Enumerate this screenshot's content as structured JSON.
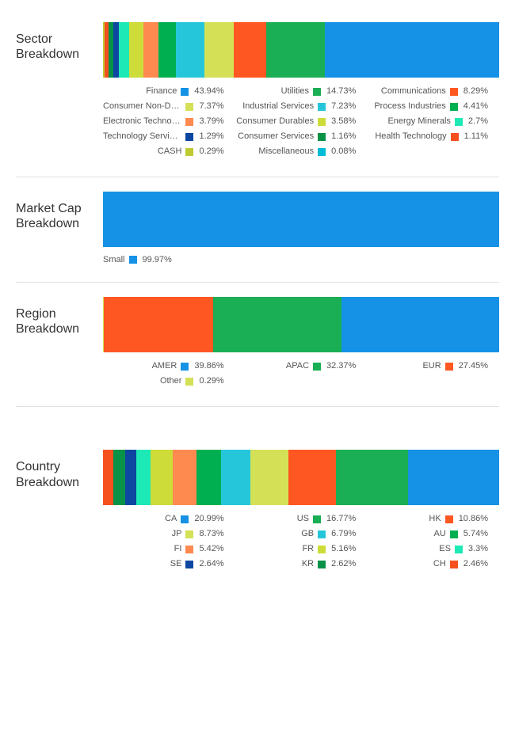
{
  "sections": [
    {
      "title": "Sector Breakdown",
      "legend_cols": 3,
      "items": [
        {
          "label": "Finance",
          "value": 43.94,
          "display": "43.94%",
          "color": "#1592e6"
        },
        {
          "label": "Utilities",
          "value": 14.73,
          "display": "14.73%",
          "color": "#1aaf54"
        },
        {
          "label": "Communications",
          "value": 8.29,
          "display": "8.29%",
          "color": "#ff5722"
        },
        {
          "label": "Consumer Non-Durables",
          "value": 7.37,
          "display": "7.37%",
          "color": "#d4e157"
        },
        {
          "label": "Industrial Services",
          "value": 7.23,
          "display": "7.23%",
          "color": "#26c6da"
        },
        {
          "label": "Process Industries",
          "value": 4.41,
          "display": "4.41%",
          "color": "#00b050"
        },
        {
          "label": "Electronic Technology",
          "value": 3.79,
          "display": "3.79%",
          "color": "#ff8a50"
        },
        {
          "label": "Consumer Durables",
          "value": 3.58,
          "display": "3.58%",
          "color": "#cddc39"
        },
        {
          "label": "Energy Minerals",
          "value": 2.7,
          "display": "2.7%",
          "color": "#1de9b6"
        },
        {
          "label": "Technology Services",
          "value": 1.29,
          "display": "1.29%",
          "color": "#0d47a1"
        },
        {
          "label": "Consumer Services",
          "value": 1.16,
          "display": "1.16%",
          "color": "#089247"
        },
        {
          "label": "Health Technology",
          "value": 1.11,
          "display": "1.11%",
          "color": "#f4511e"
        },
        {
          "label": "CASH",
          "value": 0.29,
          "display": "0.29%",
          "color": "#c0ca33"
        },
        {
          "label": "Miscellaneous",
          "value": 0.08,
          "display": "0.08%",
          "color": "#00bcd4"
        }
      ]
    },
    {
      "title": "Market Cap Breakdown",
      "legend_cols": 1,
      "items": [
        {
          "label": "Small",
          "value": 99.97,
          "display": "99.97%",
          "color": "#1592e6"
        }
      ]
    },
    {
      "title": "Region Breakdown",
      "legend_cols": 3,
      "items": [
        {
          "label": "AMER",
          "value": 39.86,
          "display": "39.86%",
          "color": "#1592e6"
        },
        {
          "label": "APAC",
          "value": 32.37,
          "display": "32.37%",
          "color": "#1aaf54"
        },
        {
          "label": "EUR",
          "value": 27.45,
          "display": "27.45%",
          "color": "#ff5722"
        },
        {
          "label": "Other",
          "value": 0.29,
          "display": "0.29%",
          "color": "#d4e157"
        }
      ]
    },
    {
      "title": "Country Breakdown",
      "legend_cols": 3,
      "spacer_before": true,
      "items": [
        {
          "label": "CA",
          "value": 20.99,
          "display": "20.99%",
          "color": "#1592e6"
        },
        {
          "label": "US",
          "value": 16.77,
          "display": "16.77%",
          "color": "#1aaf54"
        },
        {
          "label": "HK",
          "value": 10.86,
          "display": "10.86%",
          "color": "#ff5722"
        },
        {
          "label": "JP",
          "value": 8.73,
          "display": "8.73%",
          "color": "#d4e157"
        },
        {
          "label": "GB",
          "value": 6.79,
          "display": "6.79%",
          "color": "#26c6da"
        },
        {
          "label": "AU",
          "value": 5.74,
          "display": "5.74%",
          "color": "#00b050"
        },
        {
          "label": "FI",
          "value": 5.42,
          "display": "5.42%",
          "color": "#ff8a50"
        },
        {
          "label": "FR",
          "value": 5.16,
          "display": "5.16%",
          "color": "#cddc39"
        },
        {
          "label": "ES",
          "value": 3.3,
          "display": "3.3%",
          "color": "#1de9b6"
        },
        {
          "label": "SE",
          "value": 2.64,
          "display": "2.64%",
          "color": "#0d47a1"
        },
        {
          "label": "KR",
          "value": 2.62,
          "display": "2.62%",
          "color": "#089247"
        },
        {
          "label": "CH",
          "value": 2.46,
          "display": "2.46%",
          "color": "#f4511e"
        }
      ]
    }
  ],
  "chart_data": [
    {
      "type": "bar",
      "title": "Sector Breakdown",
      "orientation": "stacked-horizontal",
      "unit": "%",
      "series": [
        {
          "name": "Finance",
          "value": 43.94
        },
        {
          "name": "Utilities",
          "value": 14.73
        },
        {
          "name": "Communications",
          "value": 8.29
        },
        {
          "name": "Consumer Non-Durables",
          "value": 7.37
        },
        {
          "name": "Industrial Services",
          "value": 7.23
        },
        {
          "name": "Process Industries",
          "value": 4.41
        },
        {
          "name": "Electronic Technology",
          "value": 3.79
        },
        {
          "name": "Consumer Durables",
          "value": 3.58
        },
        {
          "name": "Energy Minerals",
          "value": 2.7
        },
        {
          "name": "Technology Services",
          "value": 1.29
        },
        {
          "name": "Consumer Services",
          "value": 1.16
        },
        {
          "name": "Health Technology",
          "value": 1.11
        },
        {
          "name": "CASH",
          "value": 0.29
        },
        {
          "name": "Miscellaneous",
          "value": 0.08
        }
      ]
    },
    {
      "type": "bar",
      "title": "Market Cap Breakdown",
      "orientation": "stacked-horizontal",
      "unit": "%",
      "series": [
        {
          "name": "Small",
          "value": 99.97
        }
      ]
    },
    {
      "type": "bar",
      "title": "Region Breakdown",
      "orientation": "stacked-horizontal",
      "unit": "%",
      "series": [
        {
          "name": "AMER",
          "value": 39.86
        },
        {
          "name": "APAC",
          "value": 32.37
        },
        {
          "name": "EUR",
          "value": 27.45
        },
        {
          "name": "Other",
          "value": 0.29
        }
      ]
    },
    {
      "type": "bar",
      "title": "Country Breakdown",
      "orientation": "stacked-horizontal",
      "unit": "%",
      "series": [
        {
          "name": "CA",
          "value": 20.99
        },
        {
          "name": "US",
          "value": 16.77
        },
        {
          "name": "HK",
          "value": 10.86
        },
        {
          "name": "JP",
          "value": 8.73
        },
        {
          "name": "GB",
          "value": 6.79
        },
        {
          "name": "AU",
          "value": 5.74
        },
        {
          "name": "FI",
          "value": 5.42
        },
        {
          "name": "FR",
          "value": 5.16
        },
        {
          "name": "ES",
          "value": 3.3
        },
        {
          "name": "SE",
          "value": 2.64
        },
        {
          "name": "KR",
          "value": 2.62
        },
        {
          "name": "CH",
          "value": 2.46
        }
      ]
    }
  ]
}
